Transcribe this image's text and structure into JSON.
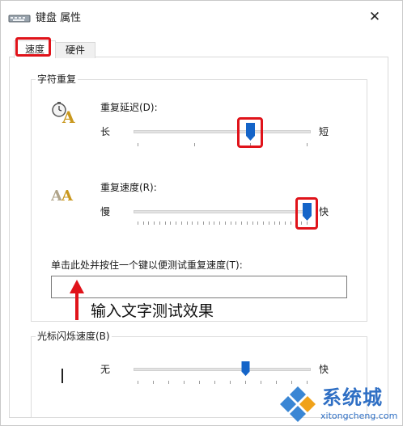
{
  "window": {
    "title": "键盘 属性",
    "close_glyph": "✕"
  },
  "tabs": [
    {
      "label": "速度",
      "selected": true
    },
    {
      "label": "硬件",
      "selected": false
    }
  ],
  "char_repeat": {
    "group_label": "字符重复",
    "delay": {
      "label": "重复延迟(D):",
      "min_label": "长",
      "max_label": "短",
      "value": 2,
      "max": 3,
      "icon": "stopwatch-a-icon"
    },
    "rate": {
      "label": "重复速度(R):",
      "min_label": "慢",
      "max_label": "快",
      "value": 31,
      "max": 31,
      "icon": "repeat-aa-icon"
    },
    "test_label": "单击此处并按住一个键以便测试重复速度(T):",
    "test_value": ""
  },
  "annotation": {
    "text": "输入文字测试效果",
    "color": "#e0131a"
  },
  "cursor_blink": {
    "group_label": "光标闪烁速度(B)",
    "min_label": "无",
    "max_label": "快",
    "value": 7,
    "max": 11
  },
  "watermark": {
    "main": "系统城",
    "sub": "xitongcheng.com"
  },
  "colors": {
    "accent": "#1464c8",
    "highlight": "#e0131a",
    "watermark": "#2f6fc4"
  }
}
